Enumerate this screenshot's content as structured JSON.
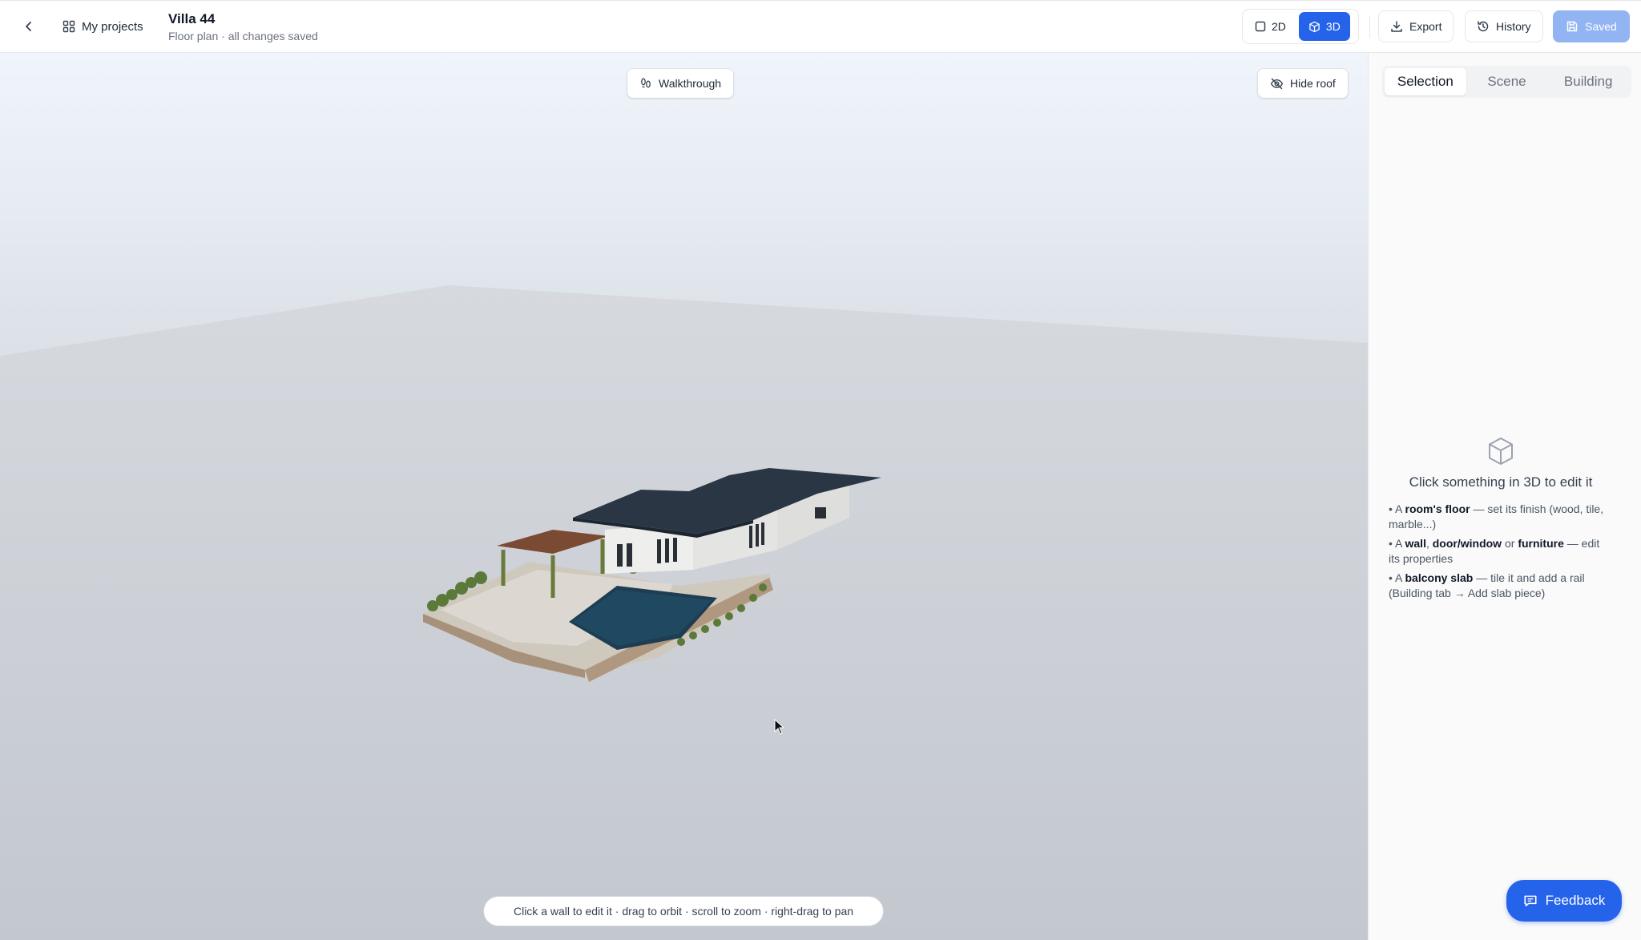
{
  "header": {
    "back_icon": "chevron-left-icon",
    "projects_label": "My projects",
    "projects_icon": "grid-icon",
    "title": "Villa 44",
    "subtitle": "Floor plan · all changes saved",
    "view_2d_label": "2D",
    "view_3d_label": "3D",
    "active_view": "3D",
    "export_label": "Export",
    "history_label": "History",
    "saved_label": "Saved"
  },
  "viewport": {
    "walkthrough_label": "Walkthrough",
    "hide_roof_label": "Hide roof",
    "hint": "Click a wall to edit it · drag to orbit · scroll to zoom · right-drag to pan"
  },
  "panel": {
    "tabs": [
      "Selection",
      "Scene",
      "Building"
    ],
    "active_tab": "Selection",
    "empty_title": "Click something in 3D to edit it",
    "tips": [
      {
        "prefix": "A ",
        "bold1": "room's floor",
        "text1": " — set its finish (wood, tile, marble...)"
      },
      {
        "prefix": "A ",
        "bold1": "wall",
        "text1": ", ",
        "bold2": "door/window",
        "text2": " or ",
        "bold3": "furniture",
        "text3": " — edit its properties"
      },
      {
        "prefix": "A ",
        "bold1": "balcony slab",
        "text1": " — tile it and add a rail (Building tab → Add slab piece)"
      }
    ]
  },
  "feedback_label": "Feedback",
  "colors": {
    "accent": "#2563eb",
    "saved_bg": "#93b4f3"
  }
}
